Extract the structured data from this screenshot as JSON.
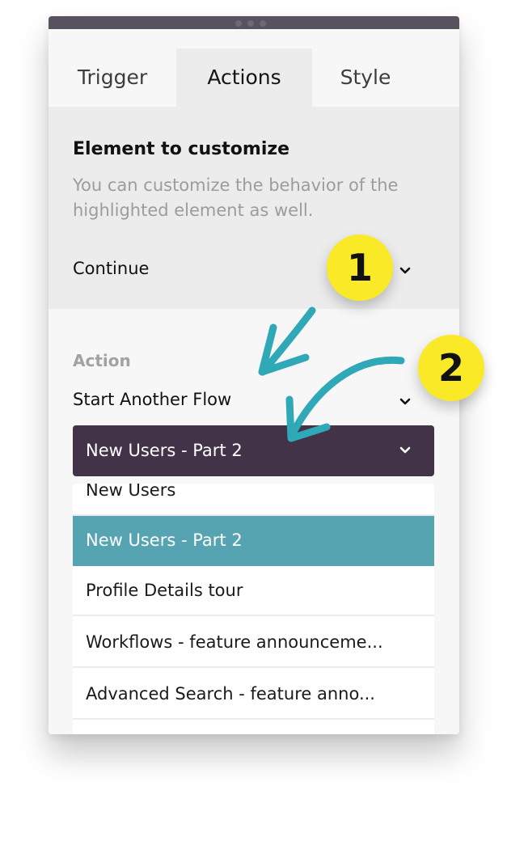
{
  "window": {
    "drag_handle": "window-drag-handle"
  },
  "tabs": [
    {
      "label": "Trigger",
      "active": false
    },
    {
      "label": "Actions",
      "active": true
    },
    {
      "label": "Style",
      "active": false
    }
  ],
  "element_section": {
    "title": "Element to customize",
    "description": "You can customize the behavior of the highlighted element as well.",
    "selected_element": "Continue"
  },
  "action_section": {
    "label": "Action",
    "action_value": "Start Another Flow",
    "flow_value": "New Users - Part 2",
    "flow_options": [
      {
        "label": "New Users",
        "selected": false
      },
      {
        "label": "New Users - Part 2",
        "selected": true
      },
      {
        "label": "Profile Details tour",
        "selected": false
      },
      {
        "label": "Workflows - feature announceme...",
        "selected": false
      },
      {
        "label": "Advanced Search - feature anno...",
        "selected": false
      },
      {
        "label": "",
        "selected": false
      }
    ]
  },
  "annotations": {
    "badge_1": "1",
    "badge_2": "2",
    "badge_color": "#f9e927",
    "arrow_color": "#2fa8b7"
  },
  "colors": {
    "topbar": "#57525e",
    "selected_dark": "#433348",
    "option_selected": "#56a4b1"
  }
}
